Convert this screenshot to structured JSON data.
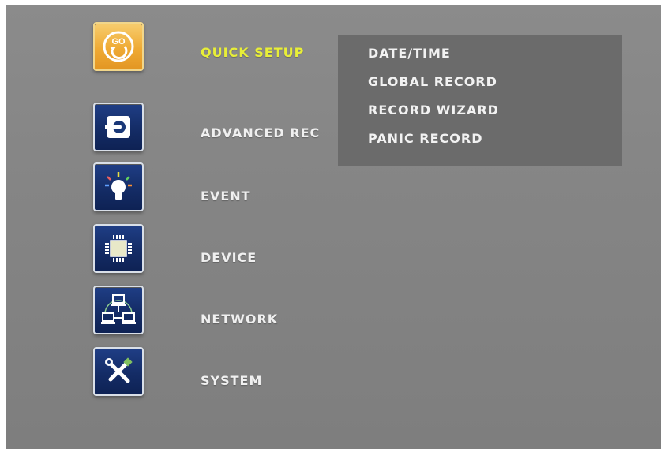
{
  "colors": {
    "background": "#858585",
    "submenu_background": "#6b6b6b",
    "label_text": "#f0f0f0",
    "active_label_text": "#e8ee38",
    "icon_tile": "#1a3878",
    "active_icon_tile": "#efaa34"
  },
  "menu": {
    "items": [
      {
        "label": "QUICK SETUP",
        "icon": "go-icon",
        "active": true
      },
      {
        "label": "ADVANCED REC",
        "icon": "record-disc-icon",
        "active": false
      },
      {
        "label": "EVENT",
        "icon": "lightbulb-icon",
        "active": false
      },
      {
        "label": "DEVICE",
        "icon": "chip-icon",
        "active": false
      },
      {
        "label": "NETWORK",
        "icon": "network-icon",
        "active": false
      },
      {
        "label": "SYSTEM",
        "icon": "tools-icon",
        "active": false
      }
    ]
  },
  "submenu": {
    "items": [
      "DATE/TIME",
      "GLOBAL RECORD",
      "RECORD WIZARD",
      "PANIC RECORD"
    ]
  },
  "go_icon_text": "GO"
}
